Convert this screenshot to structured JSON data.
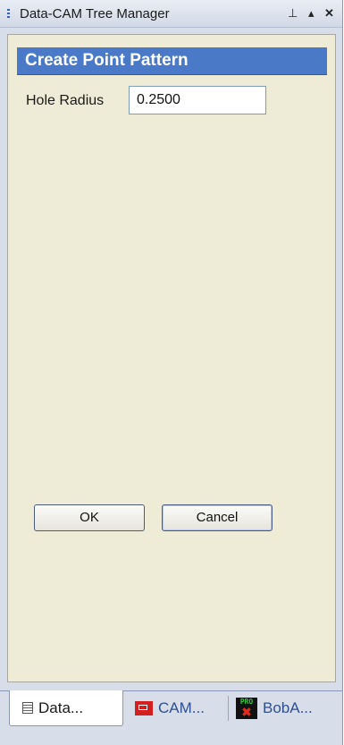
{
  "window": {
    "title": "Data-CAM Tree Manager",
    "pin_glyph": "⊥",
    "menu_glyph": "▴",
    "close_glyph": "✕"
  },
  "dialog": {
    "header": "Create Point Pattern",
    "hole_radius_label": "Hole Radius",
    "hole_radius_value": "0.2500",
    "ok_label": "OK",
    "cancel_label": "Cancel"
  },
  "tabs": [
    {
      "label": "Data...",
      "icon": "grid-icon"
    },
    {
      "label": "CAM...",
      "icon": "cam-icon"
    },
    {
      "label": "BobA...",
      "icon": "pro-x-icon",
      "badge": "PRO"
    }
  ],
  "colors": {
    "header_bg": "#4a79c8",
    "content_bg": "#eeebd6",
    "frame_bg": "#d7dde9"
  }
}
